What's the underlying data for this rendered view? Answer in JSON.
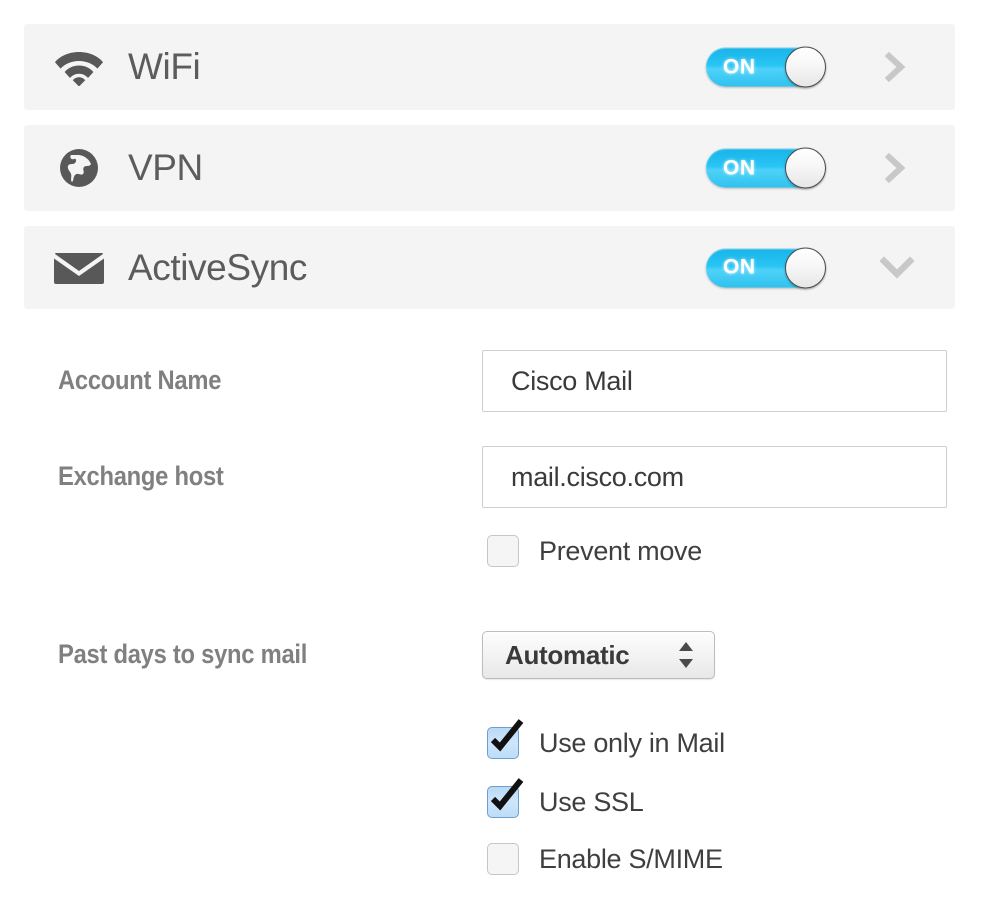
{
  "services": [
    {
      "id": "wifi",
      "label": "WiFi",
      "icon": "wifi-icon",
      "toggle_label": "ON",
      "toggle_state": "on",
      "chevron": "chevron-right-icon",
      "expanded": false
    },
    {
      "id": "vpn",
      "label": "VPN",
      "icon": "globe-icon",
      "toggle_label": "ON",
      "toggle_state": "on",
      "chevron": "chevron-right-icon",
      "expanded": false
    },
    {
      "id": "activesync",
      "label": "ActiveSync",
      "icon": "envelope-icon",
      "toggle_label": "ON",
      "toggle_state": "on",
      "chevron": "chevron-down-icon",
      "expanded": true
    }
  ],
  "form": {
    "account_name": {
      "label": "Account Name",
      "value": "Cisco Mail",
      "placeholder": ""
    },
    "exchange_host": {
      "label": "Exchange host",
      "value": "mail.cisco.com",
      "placeholder": ""
    },
    "prevent_move": {
      "label": "Prevent move",
      "checked": false
    },
    "past_days": {
      "label": "Past days to sync mail",
      "selected": "Automatic",
      "options": [
        "Automatic"
      ]
    },
    "use_only_in_mail": {
      "label": "Use only in Mail",
      "checked": true
    },
    "use_ssl": {
      "label": "Use SSL",
      "checked": true
    },
    "enable_smime": {
      "label": "Enable S/MIME",
      "checked": false
    }
  },
  "colors": {
    "row_background": "#f4f4f4",
    "toggle_on": "#27c4f4",
    "icon_gray": "#585858",
    "label_gray": "#808080",
    "chevron_gray": "#c8c8c8",
    "checkbox_checked": "#cfe6fb"
  }
}
